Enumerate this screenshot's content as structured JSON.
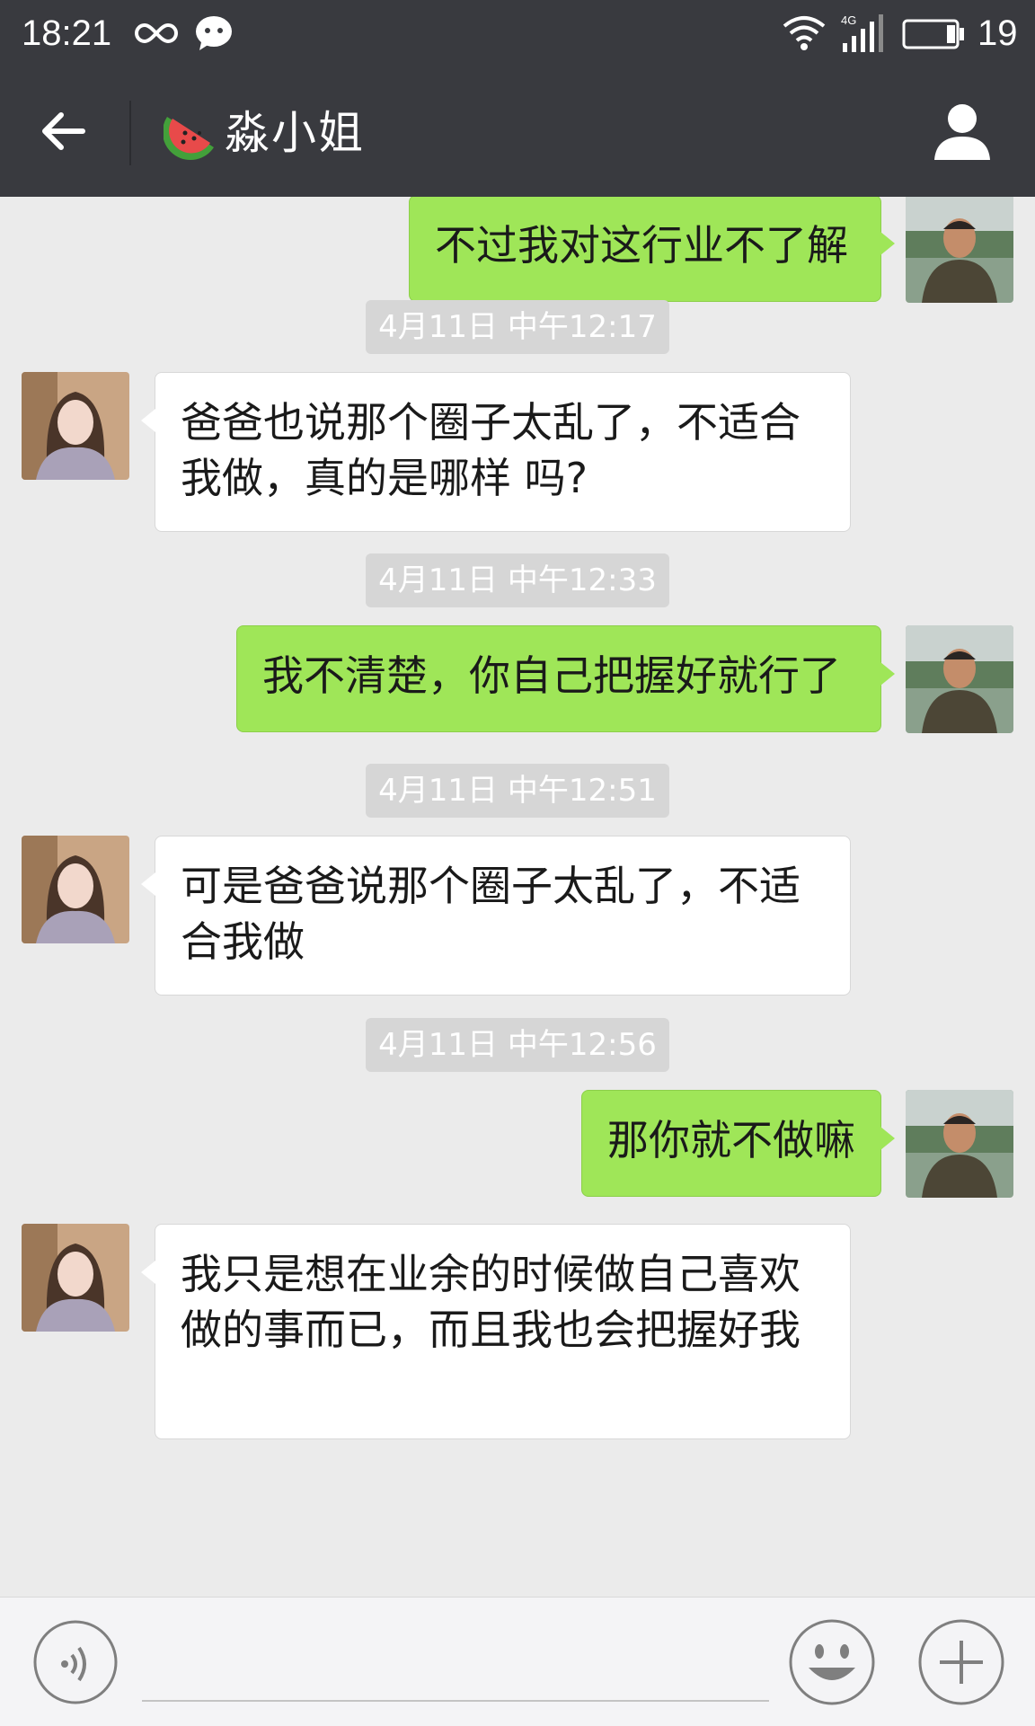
{
  "status_bar": {
    "time": "18:21",
    "network": "4G",
    "battery": "19"
  },
  "nav": {
    "title": "淼小姐",
    "title_icon": "watermelon-icon",
    "back_icon": "arrow-left-icon",
    "profile_icon": "person-icon"
  },
  "messages": [
    {
      "kind": "outgoing",
      "text": "不过我对这行业不了解"
    },
    {
      "kind": "timestamp",
      "text": "4月11日 中午12:17"
    },
    {
      "kind": "incoming",
      "text": "爸爸也说那个圈子太乱了，不适合我做，真的是哪样 吗?"
    },
    {
      "kind": "timestamp",
      "text": "4月11日 中午12:33"
    },
    {
      "kind": "outgoing",
      "text": "我不清楚，你自己把握好就行了"
    },
    {
      "kind": "timestamp",
      "text": "4月11日 中午12:51"
    },
    {
      "kind": "incoming",
      "text": "可是爸爸说那个圈子太乱了，不适合我做"
    },
    {
      "kind": "timestamp",
      "text": "4月11日 中午12:56"
    },
    {
      "kind": "outgoing",
      "text": "那你就不做嘛"
    },
    {
      "kind": "incoming",
      "text": "我只是想在业余的时候做自己喜欢做的事而已，而且我也会把握好我"
    }
  ],
  "input_bar": {
    "placeholder": "",
    "voice_icon": "voice-icon",
    "emoji_icon": "smiley-icon",
    "plus_icon": "plus-icon"
  },
  "colors": {
    "header": "#393a3f",
    "background": "#ebebeb",
    "outgoing_bubble": "#9fe658",
    "incoming_bubble": "#ffffff",
    "timestamp_bg": "#d6d6d6"
  }
}
